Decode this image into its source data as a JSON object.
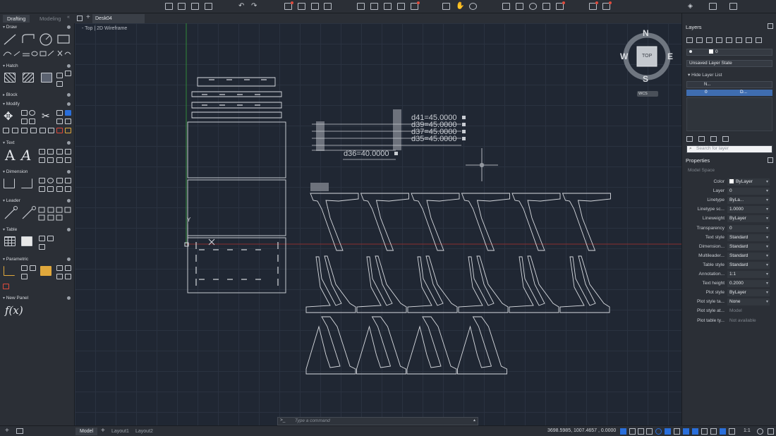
{
  "workspace_tabs": [
    "Drafting",
    "Modeling"
  ],
  "file_tab": "Desk04",
  "view_label": "-  Top  |  2D Wireframe",
  "palette": {
    "sections": [
      "Draw",
      "Hatch",
      "Block",
      "Modify",
      "Text",
      "Dimension",
      "Leader",
      "Table",
      "Parametric",
      "New Panel"
    ]
  },
  "viewcube": {
    "n": "N",
    "s": "S",
    "e": "E",
    "w": "W",
    "face": "TOP",
    "wcs": "WCS"
  },
  "dimensions": [
    "d41=45.0000",
    "d39=45.0000",
    "d37=45.0000",
    "d35=45.0000",
    "d36=40.0000"
  ],
  "ucs_label": "Y",
  "command": {
    "placeholder": "Type a command",
    "prompt": ">_"
  },
  "layout_tabs": [
    "Model",
    "Layout1",
    "Layout2"
  ],
  "coordinates": "3698.5985, 1007.4657 , 0.0000",
  "zoom_scale": "1:1",
  "layers": {
    "title": "Layers",
    "current_layer": "0",
    "layer_state": "Unsaved Layer State",
    "hide_list": "Hide Layer List",
    "col_name": "N...",
    "row_name": "0",
    "row_desc": "D...",
    "search_placeholder": "Search for layer"
  },
  "properties": {
    "title": "Properties",
    "space": "Model Space",
    "rows": [
      {
        "label": "Color",
        "value": "ByLayer"
      },
      {
        "label": "Layer",
        "value": "0"
      },
      {
        "label": "Linetype",
        "value": "ByLa..."
      },
      {
        "label": "Linetype sc...",
        "value": "1.0000"
      },
      {
        "label": "Lineweight",
        "value": "ByLayer"
      },
      {
        "label": "Transparency",
        "value": "0"
      },
      {
        "label": "Text style",
        "value": "Standard"
      },
      {
        "label": "Dimension...",
        "value": "Standard"
      },
      {
        "label": "Multileader...",
        "value": "Standard"
      },
      {
        "label": "Table style",
        "value": "Standard"
      },
      {
        "label": "Annotation...",
        "value": "1:1"
      },
      {
        "label": "Text height",
        "value": "0.2000"
      },
      {
        "label": "Plot style",
        "value": "ByLayer"
      },
      {
        "label": "Plot style ta...",
        "value": "None"
      },
      {
        "label": "Plot style at...",
        "value": "Model"
      },
      {
        "label": "Plot table ty...",
        "value": "Not available"
      }
    ]
  },
  "colors": {
    "canvas": "#202733",
    "panel": "#2b2f36",
    "accent": "#2a6fdb"
  }
}
